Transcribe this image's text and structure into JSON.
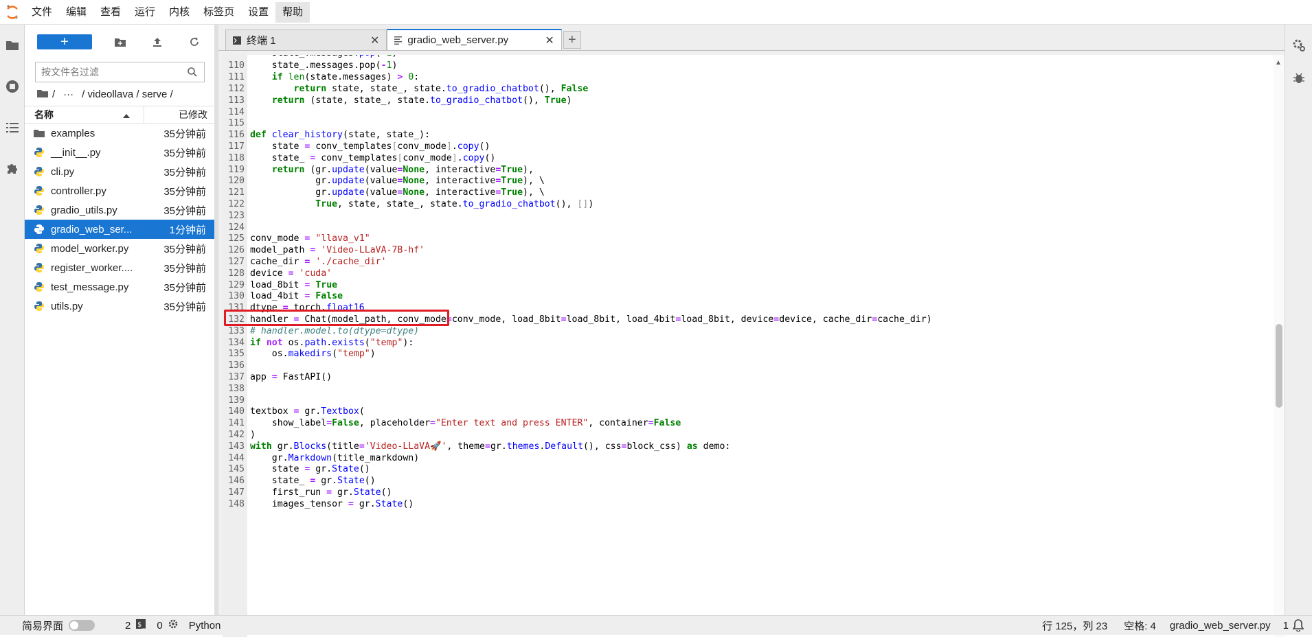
{
  "menu": [
    "文件",
    "编辑",
    "查看",
    "运行",
    "内核",
    "标签页",
    "设置",
    "帮助"
  ],
  "filebrowser": {
    "new_label": "+",
    "filter_placeholder": "按文件名过滤",
    "breadcrumb": [
      "/",
      "···",
      "/ videollava / serve /"
    ],
    "col_name": "名称",
    "col_modified": "已修改",
    "files": [
      {
        "name": "examples",
        "modified": "35分钟前",
        "type": "folder"
      },
      {
        "name": "__init__.py",
        "modified": "35分钟前",
        "type": "python"
      },
      {
        "name": "cli.py",
        "modified": "35分钟前",
        "type": "python"
      },
      {
        "name": "controller.py",
        "modified": "35分钟前",
        "type": "python"
      },
      {
        "name": "gradio_utils.py",
        "modified": "35分钟前",
        "type": "python"
      },
      {
        "name": "gradio_web_ser...",
        "modified": "1分钟前",
        "type": "python",
        "selected": true
      },
      {
        "name": "model_worker.py",
        "modified": "35分钟前",
        "type": "python"
      },
      {
        "name": "register_worker....",
        "modified": "35分钟前",
        "type": "python"
      },
      {
        "name": "test_message.py",
        "modified": "35分钟前",
        "type": "python"
      },
      {
        "name": "utils.py",
        "modified": "35分钟前",
        "type": "python"
      }
    ]
  },
  "tabs": [
    {
      "label": "终端 1",
      "icon": "terminal-icon",
      "active": false
    },
    {
      "label": "gradio_web_server.py",
      "icon": "file-text-icon",
      "active": true
    }
  ],
  "code_lines": [
    {
      "n": "110",
      "html": "    state_.messages.pop(<span class=\"op\">-</span><span class=\"num\">1</span>)"
    },
    {
      "n": "111",
      "html": "    <span class=\"kw\">if</span> <span class=\"kw\" style=\"font-weight:normal\">len</span>(state.messages) <span class=\"op\">&gt;</span> <span class=\"num\">0</span>:"
    },
    {
      "n": "112",
      "html": "        <span class=\"kw\">return</span> state, state_, state.<span class=\"fn\">to_gradio_chatbot</span>(), <span class=\"kw\">False</span>"
    },
    {
      "n": "113",
      "html": "    <span class=\"kw\">return</span> (state, state_, state.<span class=\"fn\">to_gradio_chatbot</span>(), <span class=\"kw\">True</span>)"
    },
    {
      "n": "114",
      "html": ""
    },
    {
      "n": "115",
      "html": ""
    },
    {
      "n": "116",
      "html": "<span class=\"kw\">def</span> <span class=\"fn\">clear_history</span>(state, state_):"
    },
    {
      "n": "117",
      "html": "    state <span class=\"op\">=</span> conv_templates<span class=\"br\">[</span>conv_mode<span class=\"br\">]</span>.<span class=\"fn\">copy</span>()"
    },
    {
      "n": "118",
      "html": "    state_ <span class=\"op\">=</span> conv_templates<span class=\"br\">[</span>conv_mode<span class=\"br\">]</span>.<span class=\"fn\">copy</span>()"
    },
    {
      "n": "119",
      "html": "    <span class=\"kw\">return</span> (gr.<span class=\"fn\">update</span>(value<span class=\"op\">=</span><span class=\"kw\">None</span>, interactive<span class=\"op\">=</span><span class=\"kw\">True</span>),"
    },
    {
      "n": "120",
      "html": "            gr.<span class=\"fn\">update</span>(value<span class=\"op\">=</span><span class=\"kw\">None</span>, interactive<span class=\"op\">=</span><span class=\"kw\">True</span>), \\"
    },
    {
      "n": "121",
      "html": "            gr.<span class=\"fn\">update</span>(value<span class=\"op\">=</span><span class=\"kw\">None</span>, interactive<span class=\"op\">=</span><span class=\"kw\">True</span>), \\"
    },
    {
      "n": "122",
      "html": "            <span class=\"kw\">True</span>, state, state_, state.<span class=\"fn\">to_gradio_chatbot</span>(), <span class=\"br\">[]</span>)"
    },
    {
      "n": "123",
      "html": ""
    },
    {
      "n": "124",
      "html": ""
    },
    {
      "n": "125",
      "html": "conv_mode <span class=\"op\">=</span> <span class=\"str\">\"llava_v1\"</span>"
    },
    {
      "n": "126",
      "html": "model_path <span class=\"op\">=</span> <span class=\"str\">'Video-LLaVA-7B-hf'</span>"
    },
    {
      "n": "127",
      "html": "cache_dir <span class=\"op\">=</span> <span class=\"str\">'./cache_dir'</span>"
    },
    {
      "n": "128",
      "html": "device <span class=\"op\">=</span> <span class=\"str\">'cuda'</span>"
    },
    {
      "n": "129",
      "html": "load_8bit <span class=\"op\">=</span> <span class=\"kw\">True</span>"
    },
    {
      "n": "130",
      "html": "load_4bit <span class=\"op\">=</span> <span class=\"kw\">False</span>"
    },
    {
      "n": "131",
      "html": "dtype <span class=\"op\">=</span> torch.<span class=\"fn\">float16</span>"
    },
    {
      "n": "132",
      "html": "handler <span class=\"op\">=</span> Chat(model_path, conv_mode<span class=\"op\">=</span>conv_mode, load_8bit<span class=\"op\">=</span>load_8bit, load_4bit<span class=\"op\">=</span>load_8bit, device<span class=\"op\">=</span>device, cache_dir<span class=\"op\">=</span>cache_dir)"
    },
    {
      "n": "133",
      "html": "<span class=\"cm\"># handler.model.to(dtype=dtype)</span>"
    },
    {
      "n": "134",
      "html": "<span class=\"kw\">if</span> <span class=\"op\">not</span> os.<span class=\"fn\">path</span>.<span class=\"fn\">exists</span>(<span class=\"str\">\"temp\"</span>):"
    },
    {
      "n": "135",
      "html": "    os.<span class=\"fn\">makedirs</span>(<span class=\"str\">\"temp\"</span>)"
    },
    {
      "n": "136",
      "html": ""
    },
    {
      "n": "137",
      "html": "app <span class=\"op\">=</span> FastAPI()"
    },
    {
      "n": "138",
      "html": ""
    },
    {
      "n": "139",
      "html": ""
    },
    {
      "n": "140",
      "html": "textbox <span class=\"op\">=</span> gr.<span class=\"fn\">Textbox</span>("
    },
    {
      "n": "141",
      "html": "    show_label<span class=\"op\">=</span><span class=\"kw\">False</span>, placeholder<span class=\"op\">=</span><span class=\"str\">\"Enter text and press ENTER\"</span>, container<span class=\"op\">=</span><span class=\"kw\">False</span>"
    },
    {
      "n": "142",
      "html": ")"
    },
    {
      "n": "143",
      "html": "<span class=\"kw\">with</span> gr.<span class=\"fn\">Blocks</span>(title<span class=\"op\">=</span><span class=\"str\">'Video-LLaVA🚀'</span>, theme<span class=\"op\">=</span>gr.<span class=\"fn\">themes</span>.<span class=\"fn\">Default</span>(), css<span class=\"op\">=</span>block_css) <span class=\"kw\">as</span> demo:"
    },
    {
      "n": "144",
      "html": "    gr.<span class=\"fn\">Markdown</span>(title_markdown)"
    },
    {
      "n": "145",
      "html": "    state <span class=\"op\">=</span> gr.<span class=\"fn\">State</span>()"
    },
    {
      "n": "146",
      "html": "    state_ <span class=\"op\">=</span> gr.<span class=\"fn\">State</span>()"
    },
    {
      "n": "147",
      "html": "    first_run <span class=\"op\">=</span> gr.<span class=\"fn\">State</span>()"
    },
    {
      "n": "148",
      "html": "    images_tensor <span class=\"op\">=</span> gr.<span class=\"fn\">State</span>()"
    }
  ],
  "statusbar": {
    "simple_mode": "简易界面",
    "terminals": "2",
    "kernels": "0",
    "language": "Python",
    "cursor": "行 125，列 23",
    "spaces": "空格: 4",
    "filename": "gradio_web_server.py",
    "notifications": "1"
  },
  "colors": {
    "accent": "#1976d2",
    "highlight_box": "#e01b24"
  }
}
